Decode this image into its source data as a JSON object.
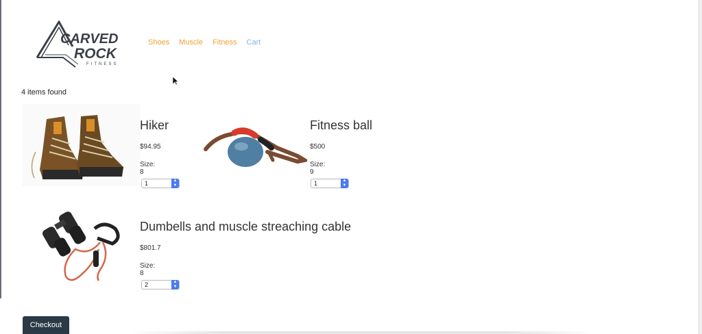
{
  "header": {
    "logo": {
      "line1": "CARVED",
      "line2": "ROCK",
      "line3": "FITNESS"
    },
    "nav": [
      {
        "label": "Shoes"
      },
      {
        "label": "Muscle"
      },
      {
        "label": "Fitness"
      },
      {
        "label": "Cart"
      }
    ]
  },
  "results": {
    "count_text": "4 items found"
  },
  "products": [
    {
      "name": "Hiker",
      "price": "$94.95",
      "size": "Size: 8",
      "quantity": "1",
      "image": "hiking-boots-image"
    },
    {
      "name": "Fitness ball",
      "price": "$500",
      "size": "Size: 9",
      "quantity": "1",
      "image": "fitness-ball-image"
    },
    {
      "name": "Dumbells and muscle streaching cable",
      "price": "$801.7",
      "size": "Size: 8",
      "quantity": "2",
      "image": "dumbbells-cable-image"
    }
  ],
  "actions": {
    "checkout_label": "Checkout"
  },
  "colors": {
    "nav_link": "#f0a032",
    "nav_cart": "#7fb8d6",
    "checkout_bg": "#2b3a45",
    "select_spin": "#4a7bf0"
  }
}
